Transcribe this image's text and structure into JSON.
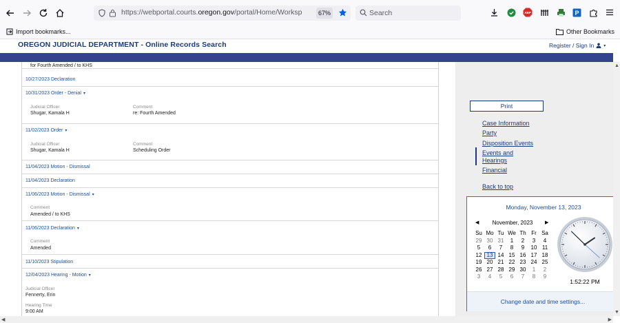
{
  "browser": {
    "url_prefix": "https://webportal.courts.",
    "url_host": "oregon.gov",
    "url_suffix": "/portal/Home/WorkspaceMode?p",
    "zoom": "67%",
    "search_placeholder": "Search",
    "bookmark_import": "Import bookmarks...",
    "bookmark_other": "Other Bookmarks"
  },
  "site": {
    "title": "OREGON JUDICIAL DEPARTMENT - Online Records Search",
    "register": "Register / Sign In"
  },
  "events": {
    "top_partial": "for Fourth Amended / to KHS",
    "items": [
      {
        "label": "10/27/2023 Declaration"
      },
      {
        "label": "10/31/2023 Order - Denial",
        "officer_label": "Judicial Officer",
        "officer": "Shugar, Kamala H",
        "comment_label": "Comment",
        "comment": "re: Fourth Amended"
      },
      {
        "label": "11/02/2023 Order",
        "officer_label": "Judicial Officer",
        "officer": "Shugar, Kamala H",
        "comment_label": "Comment",
        "comment": "Scheduling Order"
      },
      {
        "label": "11/04/2023 Motion - Dismissal"
      },
      {
        "label": "11/04/2023 Declaration"
      },
      {
        "label": "11/06/2023 Motion - Dismissal",
        "comment_label": "Comment",
        "comment": "Amended / to KHS"
      },
      {
        "label": "11/06/2023 Declaration",
        "comment_label": "Comment",
        "comment": "Amended"
      },
      {
        "label": "11/10/2023 Stipulation"
      },
      {
        "label": "12/04/2023 Hearing - Motion",
        "officer_label": "Judicial Officer",
        "officer": "Fennerty, Erin",
        "time_label": "Hearing Time",
        "time": "9:00 AM"
      }
    ]
  },
  "sidebar": {
    "print": "Print",
    "links": [
      "Case Information",
      "Party",
      "Disposition Events",
      "Events and",
      "Hearings",
      "Financial"
    ],
    "back_to_top": "Back to top"
  },
  "clock": {
    "date_long": "Monday, November 13, 2023",
    "month": "November, 2023",
    "weekdays": [
      "Su",
      "Mo",
      "Tu",
      "We",
      "Th",
      "Fr",
      "Sa"
    ],
    "weeks": [
      [
        "29",
        "30",
        "31",
        "1",
        "2",
        "3",
        "4"
      ],
      [
        "5",
        "6",
        "7",
        "8",
        "9",
        "10",
        "11"
      ],
      [
        "12",
        "13",
        "14",
        "15",
        "16",
        "17",
        "18"
      ],
      [
        "19",
        "20",
        "21",
        "22",
        "23",
        "24",
        "25"
      ],
      [
        "26",
        "27",
        "28",
        "29",
        "30",
        "1",
        "2"
      ],
      [
        "3",
        "4",
        "5",
        "6",
        "7",
        "8",
        "9"
      ]
    ],
    "time": "1:52:22 PM",
    "footer": "Change date and time settings..."
  },
  "colors": {
    "brand_navy": "#1a3a7a",
    "band": "#34438e",
    "link_blue": "#1a4f9c"
  }
}
